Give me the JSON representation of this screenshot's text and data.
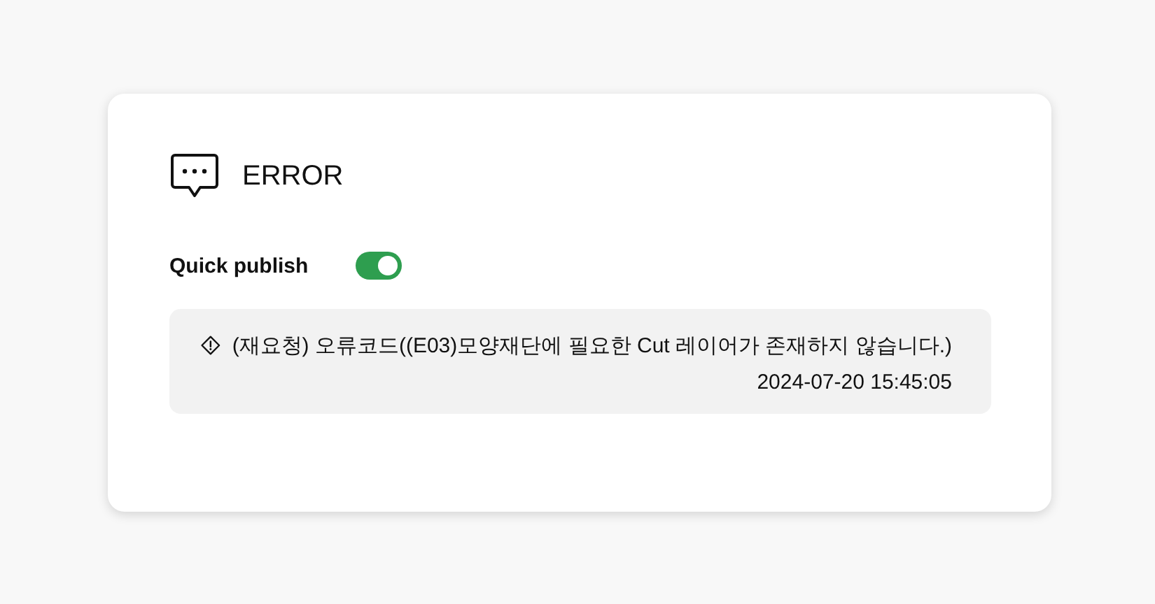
{
  "card": {
    "title": "ERROR",
    "quick_publish": {
      "label": "Quick publish",
      "on": true
    },
    "message": {
      "text": "(재요청) 오류코드((E03)모양재단에 필요한 Cut 레이어가 존재하지 않습니다.)",
      "time": "2024-07-20 15:45:05"
    }
  }
}
